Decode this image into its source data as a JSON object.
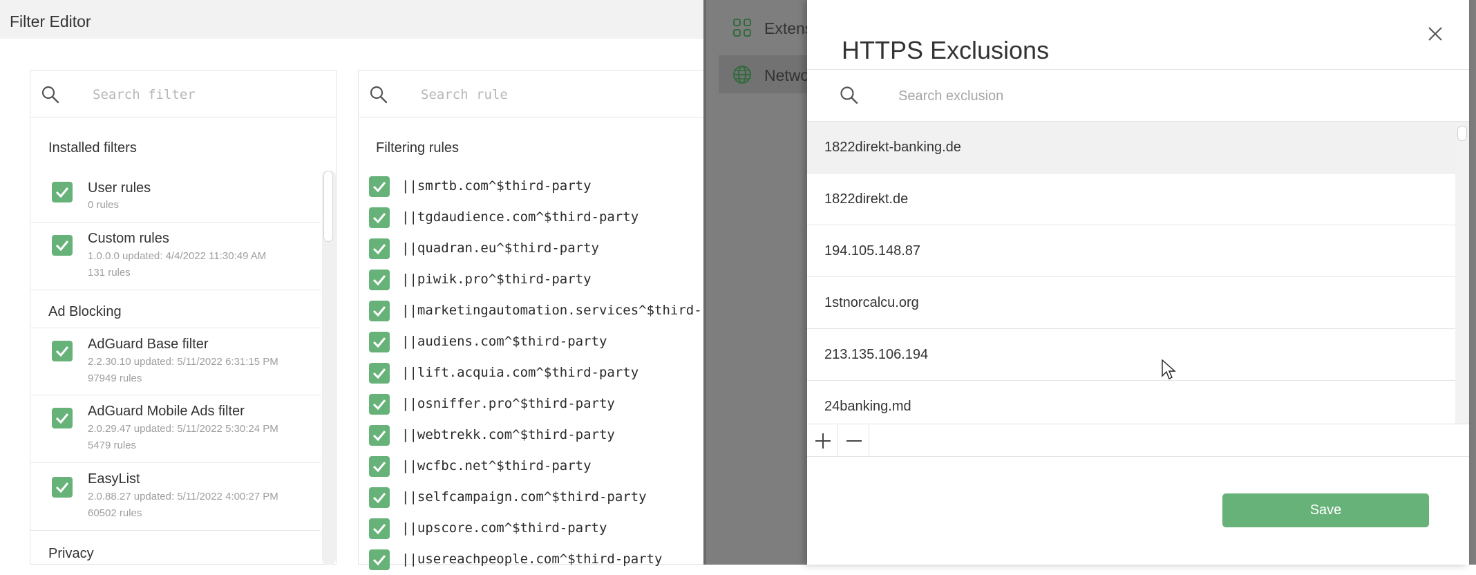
{
  "filter_editor": {
    "title": "Filter Editor",
    "filter_search_placeholder": "Search filter",
    "rule_search_placeholder": "Search rule",
    "groups": [
      {
        "title": "Installed filters",
        "filters": [
          {
            "name": "User rules",
            "meta": "0 rules",
            "meta2": "",
            "checked": true
          },
          {
            "name": "Custom rules",
            "meta": "1.0.0.0 updated: 4/4/2022 11:30:49 AM",
            "meta2": "131 rules",
            "checked": true
          }
        ]
      },
      {
        "title": "Ad Blocking",
        "filters": [
          {
            "name": "AdGuard Base filter",
            "meta": "2.2.30.10 updated: 5/11/2022 6:31:15 PM",
            "meta2": "97949 rules",
            "checked": true
          },
          {
            "name": "AdGuard Mobile Ads filter",
            "meta": "2.0.29.47 updated: 5/11/2022 5:30:24 PM",
            "meta2": "5479 rules",
            "checked": true
          },
          {
            "name": "EasyList",
            "meta": "2.0.88.27 updated: 5/11/2022 4:00:27 PM",
            "meta2": "60502 rules",
            "checked": true
          }
        ]
      },
      {
        "title": "Privacy",
        "filters": []
      }
    ],
    "rules_header": "Filtering rules",
    "rules": [
      "||smrtb.com^$third-party",
      "||tgdaudience.com^$third-party",
      "||quadran.eu^$third-party",
      "||piwik.pro^$third-party",
      "||marketingautomation.services^$third-",
      "||audiens.com^$third-party",
      "||lift.acquia.com^$third-party",
      "||osniffer.pro^$third-party",
      "||webtrekk.com^$third-party",
      "||wcfbc.net^$third-party",
      "||selfcampaign.com^$third-party",
      "||upscore.com^$third-party",
      "||usereachpeople.com^$third-party"
    ]
  },
  "settings_nav": [
    {
      "label": "Extens",
      "icon": "grid-icon",
      "active": false
    },
    {
      "label": "Netwo",
      "icon": "globe-icon",
      "active": true
    }
  ],
  "modal": {
    "title": "HTTPS Exclusions",
    "search_placeholder": "Search exclusion",
    "exclusions": [
      "1822direkt-banking.de",
      "1822direkt.de",
      "194.105.148.87",
      "1stnorcalcu.org",
      "213.135.106.194",
      "24banking.md"
    ],
    "selected_index": 0,
    "save_label": "Save"
  },
  "colors": {
    "accent_green": "#67b279",
    "overlay_gray": "#7e7e7e"
  }
}
